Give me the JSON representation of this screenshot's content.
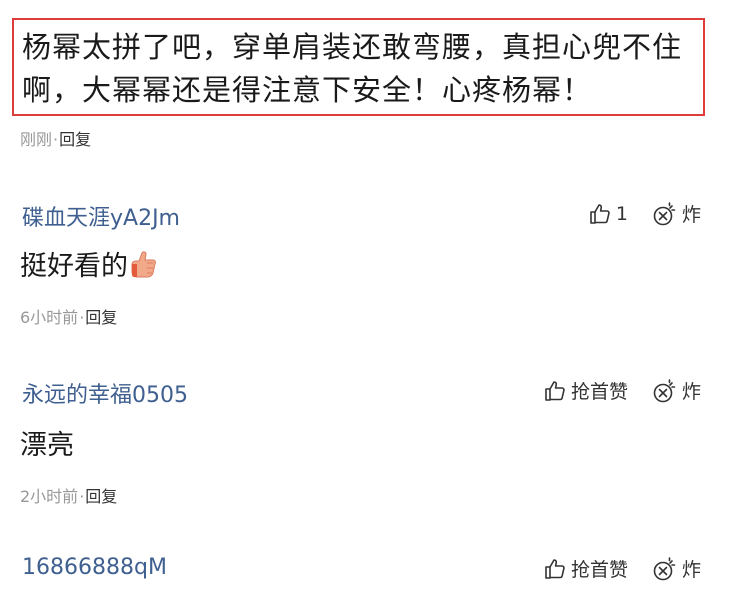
{
  "top_comment": {
    "text_line1": "杨幂太拼了吧，穿单肩装还敢弯腰，真担心兜不住",
    "text_line2": "啊，大幂幂还是得注意下安全！心疼杨幂！",
    "time": "刚刚",
    "reply_label": "回复"
  },
  "comments": [
    {
      "username": "碟血天涯yA2Jm",
      "like_label": "1",
      "bomb_label": "炸",
      "content": "挺好看的",
      "content_emoji": "thumbs-up-emoji",
      "time": "6小时前",
      "reply_label": "回复"
    },
    {
      "username": "永远的幸福0505",
      "like_label": "抢首赞",
      "bomb_label": "炸",
      "content": "漂亮",
      "time": "2小时前",
      "reply_label": "回复"
    },
    {
      "username": "16866888qM",
      "like_label": "抢首赞",
      "bomb_label": "炸"
    }
  ],
  "separator": "·",
  "icons": {
    "like": "thumb-up-outline-icon",
    "bomb": "bomb-icon"
  },
  "colors": {
    "highlight_border": "#e03b3b",
    "username": "#3e5f8f",
    "meta_text": "#999999"
  }
}
